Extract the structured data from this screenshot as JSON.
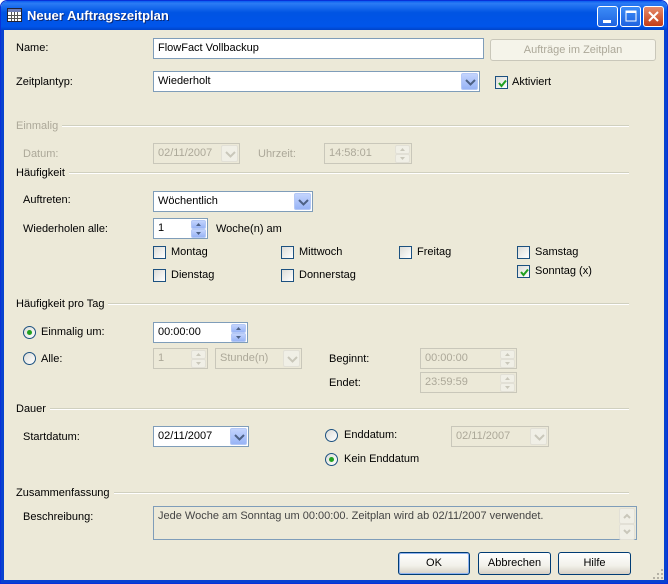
{
  "window": {
    "title": "Neuer Auftragszeitplan"
  },
  "name": {
    "label": "Name:",
    "value": "FlowFact Vollbackup",
    "jobs_button": "Aufträge im Zeitplan"
  },
  "schedule_type": {
    "label": "Zeitplantyp:",
    "value": "Wiederholt",
    "enabled_label": "Aktiviert",
    "enabled": true
  },
  "once": {
    "group": "Einmalig",
    "date_label": "Datum:",
    "date_value": "02/11/2007",
    "time_label": "Uhrzeit:",
    "time_value": "14:58:01"
  },
  "frequency": {
    "group": "Häufigkeit",
    "occurs_label": "Auftreten:",
    "occurs_value": "Wöchentlich",
    "repeat_label": "Wiederholen alle:",
    "repeat_value": "1",
    "repeat_unit": "Woche(n) am",
    "days": [
      {
        "label": "Montag",
        "checked": false
      },
      {
        "label": "Mittwoch",
        "checked": false
      },
      {
        "label": "Freitag",
        "checked": false
      },
      {
        "label": "Samstag",
        "checked": false
      },
      {
        "label": "Dienstag",
        "checked": false
      },
      {
        "label": "Donnerstag",
        "checked": false
      },
      {
        "label": "Sonntag (x)",
        "checked": true
      }
    ]
  },
  "daily": {
    "group": "Häufigkeit pro Tag",
    "once_label": "Einmalig um:",
    "once_value": "00:00:00",
    "once_selected": true,
    "every_label": "Alle:",
    "every_value": "1",
    "every_unit": "Stunde(n)",
    "start_label": "Beginnt:",
    "start_value": "00:00:00",
    "end_label": "Endet:",
    "end_value": "23:59:59"
  },
  "duration": {
    "group": "Dauer",
    "start_label": "Startdatum:",
    "start_value": "02/11/2007",
    "end_label": "Enddatum:",
    "end_value": "02/11/2007",
    "no_end_label": "Kein Enddatum",
    "no_end_selected": true
  },
  "summary": {
    "group": "Zusammenfassung",
    "desc_label": "Beschreibung:",
    "desc_value": "Jede Woche am Sonntag um 00:00:00. Zeitplan wird ab 02/11/2007 verwendet."
  },
  "buttons": {
    "ok": "OK",
    "cancel": "Abbrechen",
    "help": "Hilfe"
  },
  "colors": {
    "titlebar": "#0054e3",
    "dialog_bg": "#ece9d8",
    "field_border": "#7f9db9",
    "check_green": "#21a121"
  }
}
